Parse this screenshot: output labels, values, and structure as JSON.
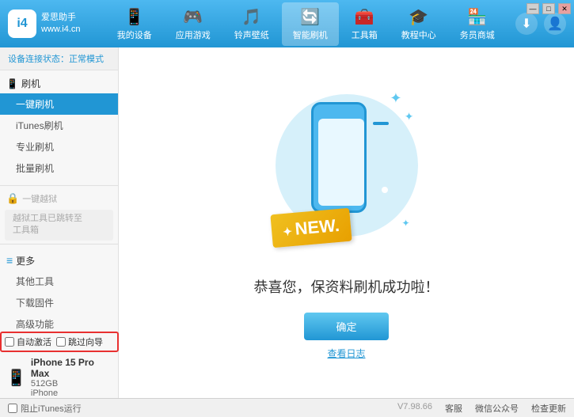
{
  "app": {
    "title": "爱思助手",
    "subtitle": "www.i4.cn"
  },
  "window_controls": {
    "min": "—",
    "max": "□",
    "close": "✕"
  },
  "header": {
    "nav": [
      {
        "id": "my-device",
        "icon": "📱",
        "label": "我的设备"
      },
      {
        "id": "apps-games",
        "icon": "🎮",
        "label": "应用游戏"
      },
      {
        "id": "ringtones",
        "icon": "🎵",
        "label": "铃声壁纸"
      },
      {
        "id": "smart-flash",
        "icon": "🔄",
        "label": "智能刷机",
        "active": true
      },
      {
        "id": "toolbox",
        "icon": "🧰",
        "label": "工具箱"
      },
      {
        "id": "tutorials",
        "icon": "🎓",
        "label": "教程中心"
      },
      {
        "id": "services",
        "icon": "🏪",
        "label": "务员商城"
      }
    ],
    "download_icon": "⬇",
    "user_icon": "👤"
  },
  "sidebar": {
    "status_label": "设备连接状态：",
    "status_value": "正常模式",
    "sections": [
      {
        "id": "flash",
        "icon": "📱",
        "label": "刷机",
        "items": [
          {
            "id": "one-click-flash",
            "label": "一键刷机",
            "active": true
          },
          {
            "id": "itunes-flash",
            "label": "iTunes刷机"
          },
          {
            "id": "pro-flash",
            "label": "专业刷机"
          },
          {
            "id": "batch-flash",
            "label": "批量刷机"
          }
        ]
      }
    ],
    "disabled_section": {
      "icon": "🔒",
      "label": "一键越狱"
    },
    "disabled_note": "越狱工具已跳转至\n工具箱",
    "more_section": {
      "icon": "≡",
      "label": "更多",
      "items": [
        {
          "id": "other-tools",
          "label": "其他工具"
        },
        {
          "id": "download-firmware",
          "label": "下载固件"
        },
        {
          "id": "advanced",
          "label": "高级功能"
        }
      ]
    },
    "auto_activate": "自动激活",
    "guide_export": "跳过向导",
    "device": {
      "name": "iPhone 15 Pro Max",
      "storage": "512GB",
      "type": "iPhone"
    },
    "itunes_label": "阻止iTunes运行"
  },
  "content": {
    "new_badge": "NEW.",
    "success_text": "恭喜您，保资料刷机成功啦！",
    "confirm_btn": "确定",
    "log_link": "查看日志"
  },
  "footer": {
    "version": "V7.98.66",
    "items": [
      "客服",
      "微信公众号",
      "检查更新"
    ]
  }
}
